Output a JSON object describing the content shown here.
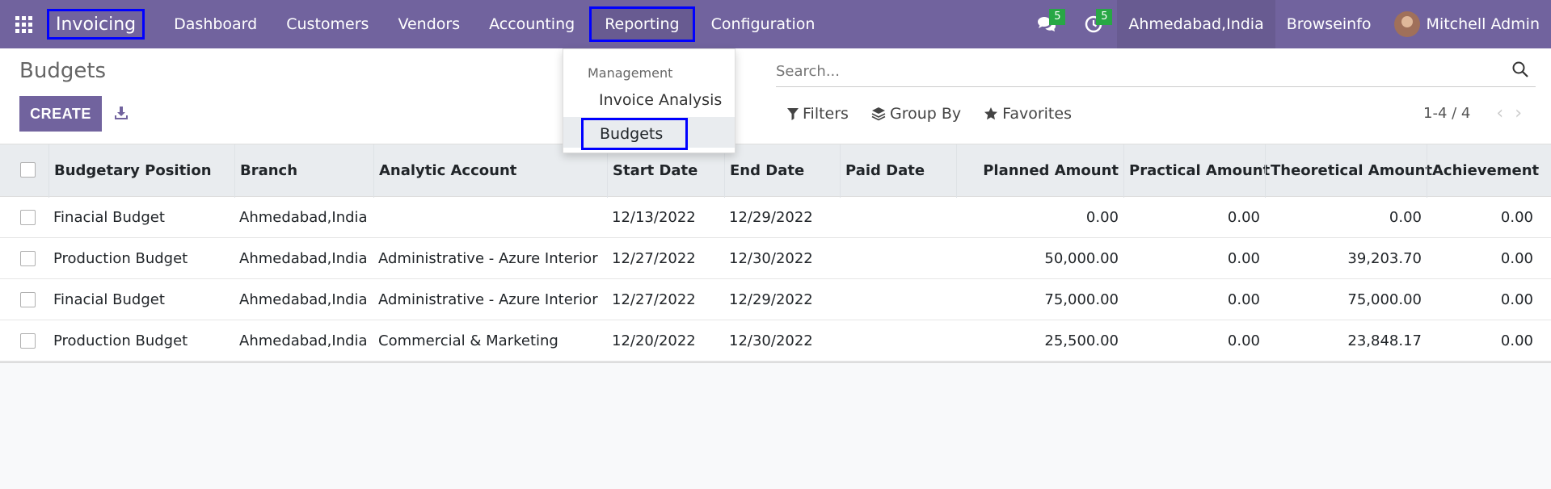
{
  "navbar": {
    "app_name": "Invoicing",
    "menu": [
      "Dashboard",
      "Customers",
      "Vendors",
      "Accounting",
      "Reporting",
      "Configuration"
    ],
    "messages_badge": "5",
    "activities_badge": "5",
    "company": "Ahmedabad,India",
    "db_name": "Browseinfo",
    "user": "Mitchell Admin",
    "accent_color": "#71639e"
  },
  "dropdown": {
    "section": "Management",
    "items": [
      "Invoice Analysis",
      "Budgets"
    ]
  },
  "control": {
    "title": "Budgets",
    "create_label": "CREATE",
    "search_placeholder": "Search...",
    "filters_label": "Filters",
    "groupby_label": "Group By",
    "favorites_label": "Favorites",
    "pager": "1-4 / 4"
  },
  "table": {
    "headers": [
      "Budgetary Position",
      "Branch",
      "Analytic Account",
      "Start Date",
      "End Date",
      "Paid Date",
      "Planned Amount",
      "Practical Amount",
      "Theoretical Amount",
      "Achievement"
    ],
    "rows": [
      [
        "Finacial Budget",
        "Ahmedabad,India",
        "",
        "12/13/2022",
        "12/29/2022",
        "",
        "0.00",
        "0.00",
        "0.00",
        "0.00"
      ],
      [
        "Production Budget",
        "Ahmedabad,India",
        "Administrative - Azure Interior",
        "12/27/2022",
        "12/30/2022",
        "",
        "50,000.00",
        "0.00",
        "39,203.70",
        "0.00"
      ],
      [
        "Finacial Budget",
        "Ahmedabad,India",
        "Administrative - Azure Interior",
        "12/27/2022",
        "12/29/2022",
        "",
        "75,000.00",
        "0.00",
        "75,000.00",
        "0.00"
      ],
      [
        "Production Budget",
        "Ahmedabad,India",
        "Commercial & Marketing",
        "12/20/2022",
        "12/30/2022",
        "",
        "25,500.00",
        "0.00",
        "23,848.17",
        "0.00"
      ]
    ]
  }
}
